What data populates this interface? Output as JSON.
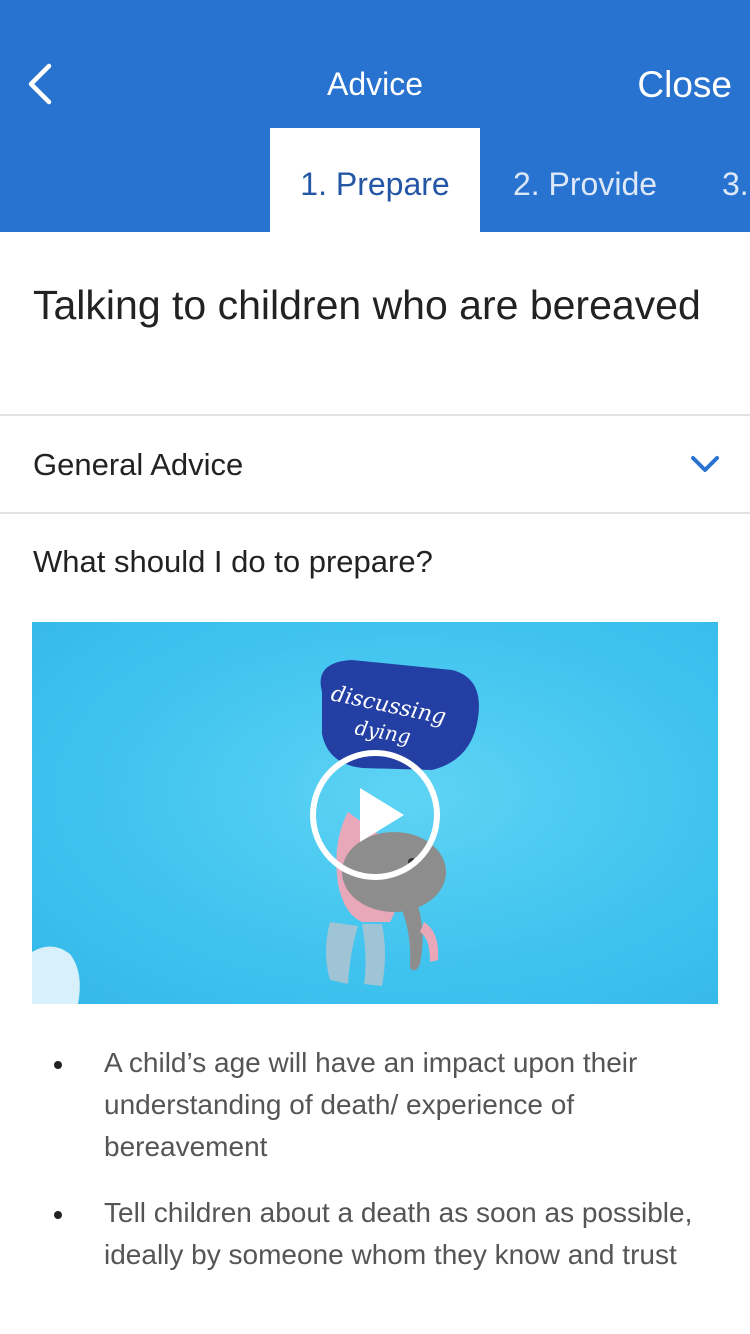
{
  "header": {
    "title": "Advice",
    "close_label": "Close",
    "back_icon": "chevron-left-icon",
    "background_color": "#2873d0"
  },
  "tabs": [
    {
      "label": "1. Prepare",
      "active": true
    },
    {
      "label": "2. Provide",
      "active": false
    },
    {
      "label": "3.",
      "active": false
    }
  ],
  "page": {
    "title": "Talking to children who are bereaved"
  },
  "accordion": {
    "label": "General Advice",
    "icon": "chevron-down-icon",
    "accent_color": "#2873d0"
  },
  "section": {
    "question": "What should I do to prepare?"
  },
  "video": {
    "caption_line1": "discussing",
    "caption_line2": "dying",
    "play_icon": "play-icon"
  },
  "bullets": [
    "A child’s age will have an impact upon their understanding of death/ experience of bereavement",
    "Tell children about a death as soon as possible, ideally by someone whom they know and trust"
  ]
}
